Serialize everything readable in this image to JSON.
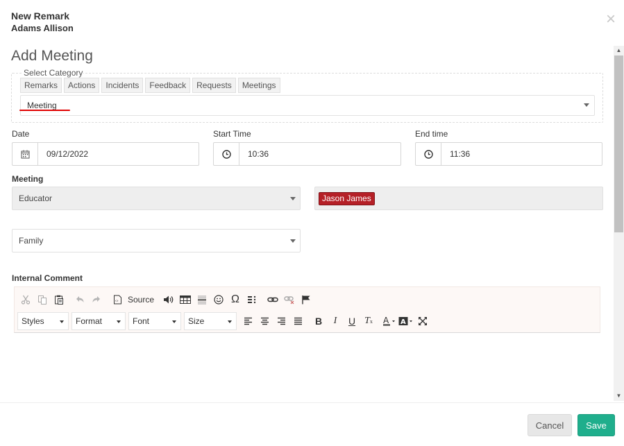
{
  "header": {
    "title": "New Remark",
    "subtitle": "Adams Allison",
    "close_icon": "×"
  },
  "form": {
    "title": "Add Meeting",
    "category": {
      "legend": "Select Category",
      "tabs": [
        "Remarks",
        "Actions",
        "Incidents",
        "Feedback",
        "Requests",
        "Meetings"
      ],
      "selected": "Meeting",
      "underline_color": "#e00000"
    },
    "date": {
      "label": "Date",
      "value": "09/12/2022",
      "icon": "calendar-icon"
    },
    "start_time": {
      "label": "Start Time",
      "value": "10:36",
      "icon": "clock-icon"
    },
    "end_time": {
      "label": "End time",
      "value": "11:36",
      "icon": "clock-icon"
    },
    "meeting": {
      "label": "Meeting",
      "type_value": "Educator",
      "participant_tag": "Jason James",
      "tag_color": "#b52027",
      "group_value": "Family"
    },
    "internal_comment": {
      "label": "Internal Comment",
      "toolbar": {
        "source_label": "Source",
        "styles": "Styles",
        "format": "Format",
        "font": "Font",
        "size": "Size"
      }
    }
  },
  "footer": {
    "cancel_label": "Cancel",
    "save_label": "Save",
    "save_color": "#1fae8c"
  }
}
